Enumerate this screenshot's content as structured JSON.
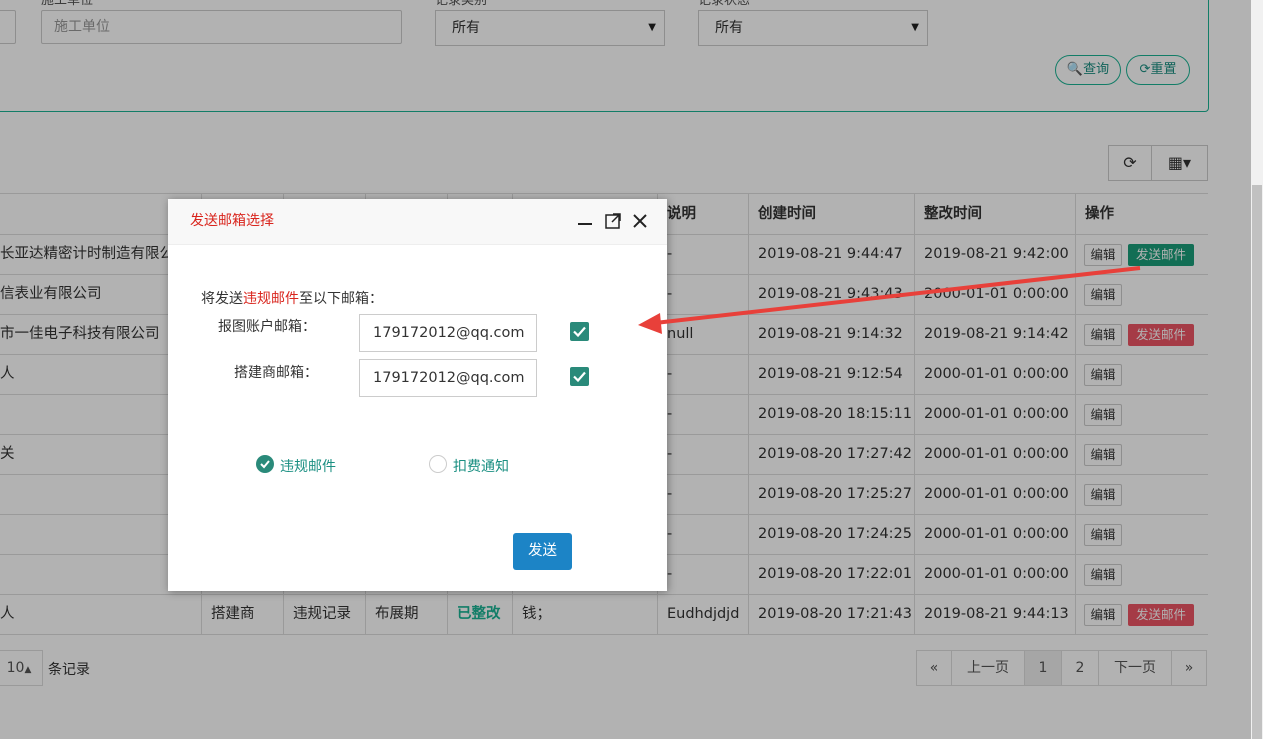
{
  "filters": {
    "unit_label_cut": "施工单位",
    "unit_placeholder": "施工单位",
    "record_type_label_cut": "记录类别",
    "record_type_value": "所有",
    "record_status_label_cut": "记录状态",
    "record_status_value": "所有",
    "query_label": "查询",
    "reset_label": "重置"
  },
  "table": {
    "headers": [
      "",
      "",
      "",
      "",
      "",
      "",
      "说明",
      "创建时间",
      "整改时间",
      "操作"
    ],
    "edit_label": "编辑",
    "mail_label": "发送邮件",
    "rows": [
      {
        "company": "长亚达精密计时制造有限公司",
        "desc": "-",
        "created": "2019-08-21 9:44:47",
        "fixed": "2019-08-21 9:42:00",
        "mail": "green"
      },
      {
        "company": "信表业有限公司",
        "desc": "-",
        "created": "2019-08-21 9:43:43",
        "fixed": "2000-01-01 0:00:00",
        "mail": ""
      },
      {
        "company": "市一佳电子科技有限公司",
        "desc": "null",
        "created": "2019-08-21 9:14:32",
        "fixed": "2019-08-21 9:14:42",
        "mail": "red"
      },
      {
        "company": "人",
        "desc": "-",
        "created": "2019-08-21 9:12:54",
        "fixed": "2000-01-01 0:00:00",
        "mail": ""
      },
      {
        "company": "",
        "desc": "-",
        "created": "2019-08-20 18:15:11",
        "fixed": "2000-01-01 0:00:00",
        "mail": ""
      },
      {
        "company": "关",
        "desc": "-",
        "created": "2019-08-20 17:27:42",
        "fixed": "2000-01-01 0:00:00",
        "mail": ""
      },
      {
        "company": "",
        "desc": "-",
        "created": "2019-08-20 17:25:27",
        "fixed": "2000-01-01 0:00:00",
        "mail": ""
      },
      {
        "company": "",
        "desc": "-",
        "created": "2019-08-20 17:24:25",
        "fixed": "2000-01-01 0:00:00",
        "mail": ""
      },
      {
        "company": "",
        "desc": "-",
        "created": "2019-08-20 17:22:01",
        "fixed": "2000-01-01 0:00:00",
        "mail": ""
      },
      {
        "company": "人",
        "role": "搭建商",
        "type": "违规记录",
        "period": "布展期",
        "status": "已整改",
        "content": "钱；",
        "desc": "Eudhdjdjd",
        "created": "2019-08-20 17:21:43",
        "fixed": "2019-08-21 9:44:13",
        "mail": "red"
      }
    ]
  },
  "pagination": {
    "page_size": "10",
    "records_suffix": "条记录",
    "first": "«",
    "prev": "上一页",
    "page1": "1",
    "page2": "2",
    "next": "下一页",
    "last": "»"
  },
  "modal": {
    "title": "发送邮箱选择",
    "intro_pre": "将发送",
    "intro_red": "违规邮件",
    "intro_post": "至以下邮箱：",
    "account_label": "报图账户邮箱：",
    "account_value": "179172012@qq.com",
    "builder_label": "搭建商邮箱：",
    "builder_value": "179172012@qq.com",
    "option_violation": "违规邮件",
    "option_fee": "扣费通知",
    "send_label": "发送"
  },
  "colors": {
    "accent": "#1ab394",
    "mail_green": "#1a9e7a",
    "mail_red": "#ed5565",
    "title_red": "#d9251d",
    "send_blue": "#1c84c6",
    "arrow_red": "#e8403a"
  }
}
